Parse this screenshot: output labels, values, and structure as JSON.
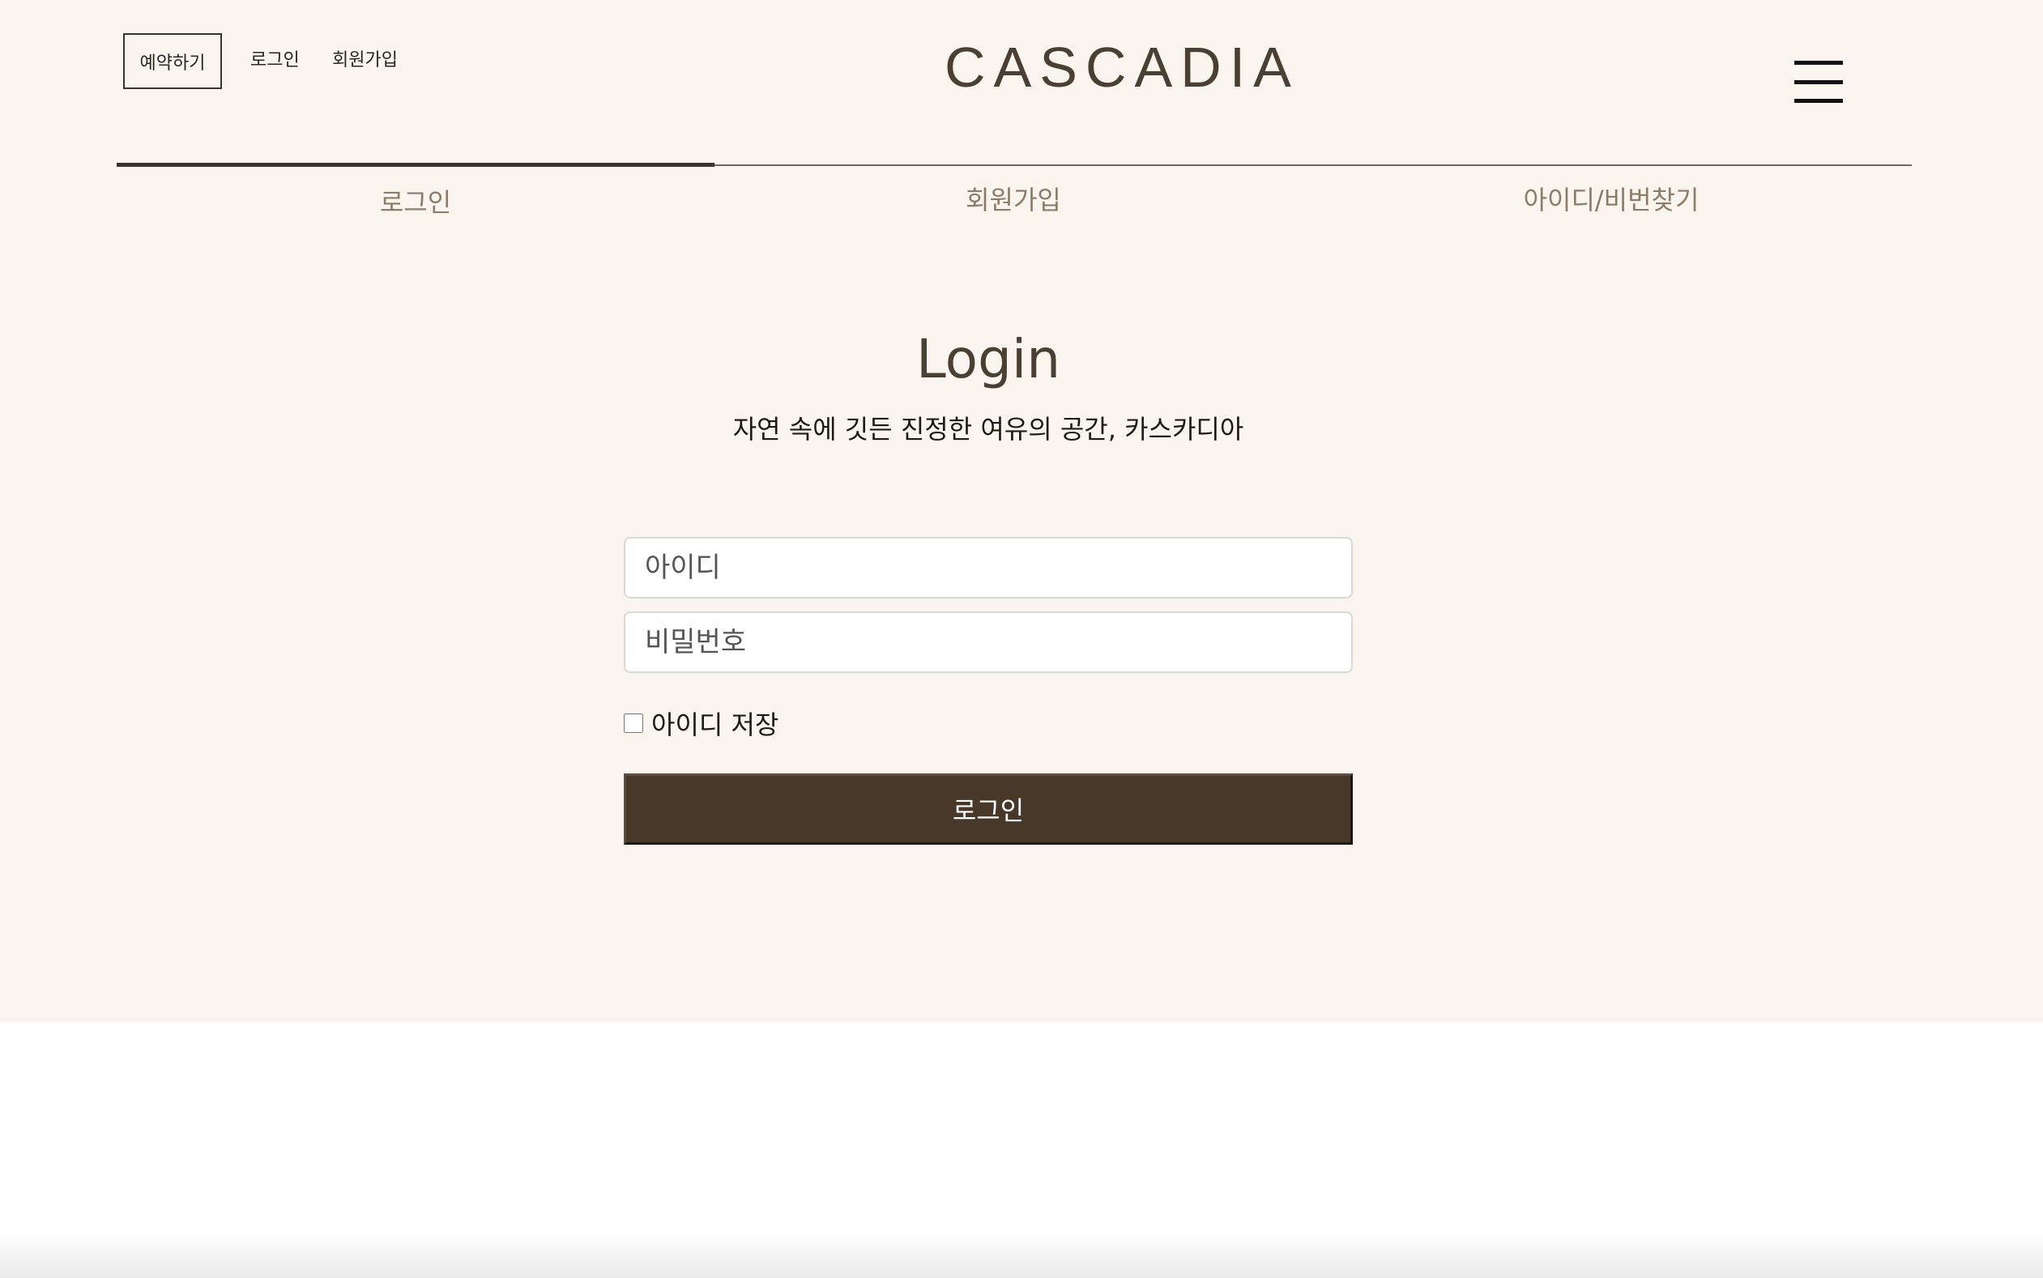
{
  "header": {
    "reserve_label": "예약하기",
    "login_link": "로그인",
    "signup_link": "회원가입",
    "logo": "CASCADIA",
    "menu_icon": "hamburger-menu-icon"
  },
  "tabs": [
    {
      "label": "로그인",
      "active": true
    },
    {
      "label": "회원가입",
      "active": false
    },
    {
      "label": "아이디/비번찾기",
      "active": false
    }
  ],
  "login": {
    "title": "Login",
    "subtitle": "자연 속에 깃든 진정한 여유의 공간, 카스카디아",
    "id_placeholder": "아이디",
    "password_placeholder": "비밀번호",
    "remember_label": "아이디 저장",
    "remember_checked": false,
    "submit_label": "로그인"
  },
  "colors": {
    "background": "#f9f5ee",
    "brand_brown": "#47382a",
    "logo_text": "#4a3f33",
    "tab_text": "#8b7c69"
  }
}
